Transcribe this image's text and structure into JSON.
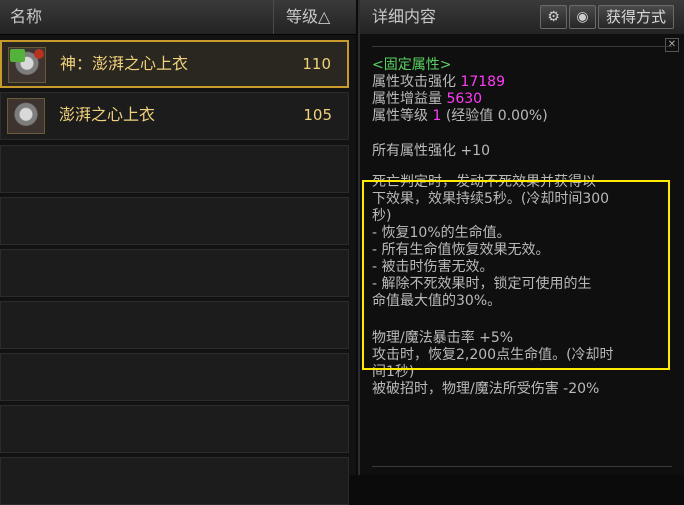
{
  "list": {
    "header": {
      "name": "名称",
      "level": "等级△"
    },
    "items": [
      {
        "name": "神：澎湃之心上衣",
        "level": "110"
      },
      {
        "name": "澎湃之心上衣",
        "level": "105"
      }
    ]
  },
  "detail": {
    "title": "详细内容",
    "obtain_button": "获得方式",
    "compare_icon": "compare-icon",
    "eye_icon": "eye-icon",
    "close_icon": "close-icon",
    "fixed_attr_header": "<固定属性>",
    "attr_attack_label": "属性攻击强化",
    "attr_attack_value": "17189",
    "attr_gain_label": "属性增益量",
    "attr_gain_value": "5630",
    "attr_level_label": "属性等级",
    "attr_level_value": "1",
    "attr_exp_text": "(经验值 0.00%)",
    "all_attr": "所有属性强化 +10",
    "effect_lines": [
      "死亡判定时，发动不死效果并获得以",
      "下效果，效果持续5秒。(冷却时间300",
      "秒)",
      "- 恢复10%的生命值。",
      "- 所有生命值恢复效果无效。",
      "- 被击时伤害无效。",
      "- 解除不死效果时，锁定可使用的生",
      "命值最大值的30%。"
    ],
    "bottom_lines": [
      "物理/魔法暴击率 +5%",
      "攻击时，恢复2,200点生命值。(冷却时",
      "间1秒)",
      "被破招时，物理/魔法所受伤害 -20%"
    ],
    "highlight_color": "#ffea00"
  }
}
